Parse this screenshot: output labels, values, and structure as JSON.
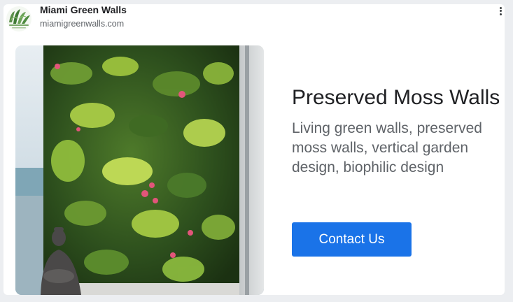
{
  "header": {
    "brand_name": "Miami Green Walls",
    "brand_url": "miamigreenwalls.com",
    "logo_icon": "plant-logo-icon",
    "menu_icon": "more-vert-icon"
  },
  "ad": {
    "headline": "Preserved Moss Walls",
    "description": "Living green walls, preserved moss walls, vertical garden design, biophilic design",
    "cta_label": "Contact Us",
    "image_subject": "vertical-garden-photo"
  },
  "colors": {
    "cta_bg": "#1a73e8",
    "card_bg": "#ffffff",
    "page_bg": "#eceef1"
  }
}
